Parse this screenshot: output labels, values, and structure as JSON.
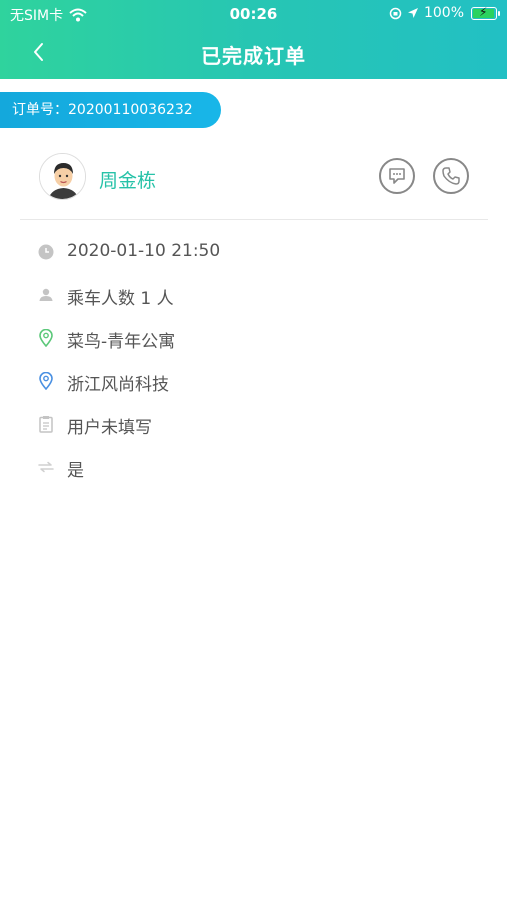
{
  "status_bar": {
    "carrier": "无SIM卡",
    "time": "00:26",
    "battery_pct": "100%"
  },
  "nav": {
    "title": "已完成订单"
  },
  "order": {
    "label": "订单号：20200110036232"
  },
  "user": {
    "name": "周金栋"
  },
  "info": {
    "datetime": "2020-01-10 21:50",
    "passengers": "乘车人数 1 人",
    "start": "菜鸟-青年公寓",
    "destination": "浙江风尚科技",
    "remark": "用户未填写",
    "flag": "是"
  },
  "colors": {
    "header_start": "#2fd39d",
    "header_end": "#22c0c4",
    "accent_teal": "#27c2a8",
    "order_pill": "#14a8dc",
    "start_pin": "#5cc87a",
    "end_pin": "#4a90e2"
  },
  "icons": {
    "clock": "clock-icon",
    "person": "person-icon",
    "start": "start-location-icon",
    "end": "end-location-icon",
    "note": "note-icon",
    "share": "share-icon"
  }
}
